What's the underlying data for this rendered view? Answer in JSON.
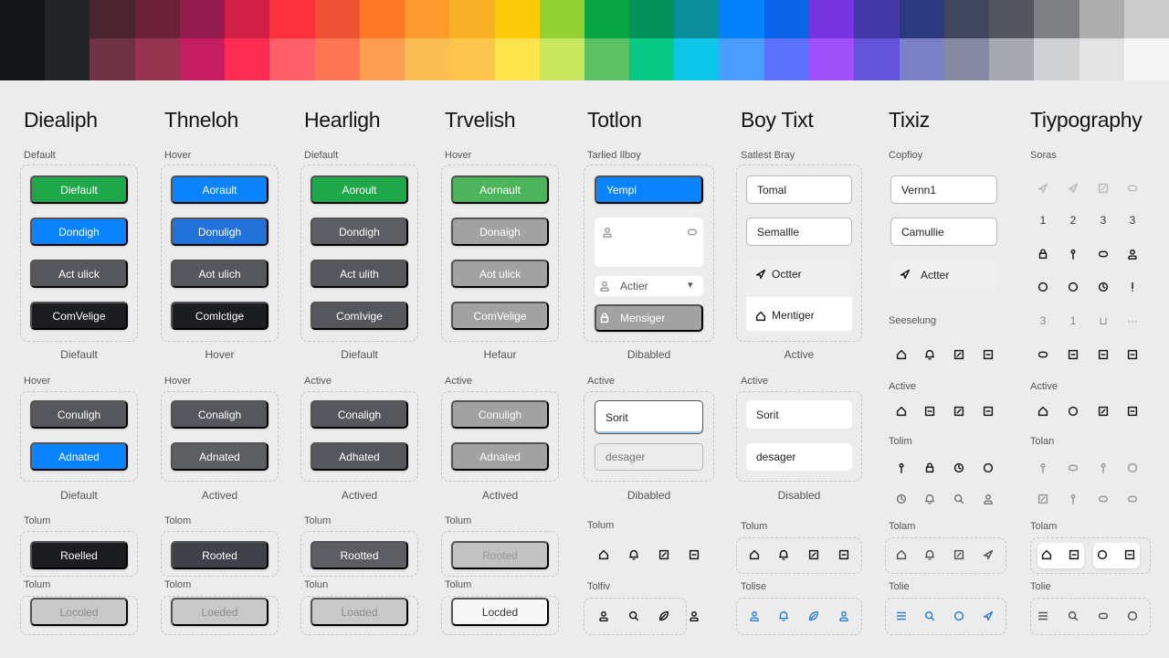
{
  "palette": {
    "top": [
      "#141518",
      "#232428",
      "#4a2530",
      "#6b2238",
      "#951a4d",
      "#d41f45",
      "#fd303b",
      "#ef5233",
      "#fe7726",
      "#fe9a2c",
      "#f8b026",
      "#fecb0a",
      "#93d032",
      "#07a544",
      "#05925a",
      "#078e9a",
      "#0482fd",
      "#0a64e8",
      "#7735e2",
      "#4438a8",
      "#2b3a7e",
      "#414760",
      "#54565f",
      "#7f8083",
      "#adadad",
      "#cccccc"
    ],
    "bottom": [
      "#141518",
      "#232428",
      "#6e3244",
      "#963450",
      "#c61e63",
      "#fd2b52",
      "#fe6068",
      "#fe7650",
      "#fe9d4f",
      "#fdbd55",
      "#fdc54b",
      "#fde44a",
      "#c9e75f",
      "#5bc263",
      "#07c885",
      "#0ec6e8",
      "#4a9dfe",
      "#5c71fe",
      "#a050fb",
      "#6353d8",
      "#7b81c7",
      "#8589a3",
      "#a6a9b0",
      "#d0d1d3",
      "#e3e3e3",
      "#f5f5f5"
    ]
  },
  "button_columns": [
    {
      "heading": "Diealiph",
      "label1": "Default",
      "buttons1": [
        {
          "text": "Diefault",
          "color": "#1ea84a"
        },
        {
          "text": "Dondigh",
          "color": "#0a84fe"
        },
        {
          "text": "Act ulick",
          "color": "#55575c"
        },
        {
          "text": "ComVelige",
          "color": "#1c1d20"
        }
      ],
      "caption1": "Diefault",
      "label2": "Hover",
      "buttons2": [
        {
          "text": "Conuligh",
          "color": "#55575c"
        },
        {
          "text": "Adnated",
          "color": "#0a84fe"
        }
      ],
      "caption2": "Diefault",
      "label3": "Tolum",
      "button3": {
        "text": "Roelled",
        "color": "#1c1d20"
      },
      "label4": "Tolum",
      "button4": {
        "text": "Locoled",
        "color": "#c9c9c9",
        "fg": "#8a8a8a"
      }
    },
    {
      "heading": "Thneloh",
      "label1": "Hover",
      "buttons1": [
        {
          "text": "Aorault",
          "color": "#0a84fe"
        },
        {
          "text": "Donuligh",
          "color": "#2271d8"
        },
        {
          "text": "Aot ulich",
          "color": "#55575c"
        },
        {
          "text": "Comlctige",
          "color": "#1c1d20"
        }
      ],
      "caption1": "Hover",
      "label2": "Hover",
      "buttons2": [
        {
          "text": "Conaligh",
          "color": "#55575c"
        },
        {
          "text": "Adnated",
          "color": "#5d5e62"
        }
      ],
      "caption2": "Actived",
      "label3": "Tolom",
      "button3": {
        "text": "Rooted",
        "color": "#3e414a"
      },
      "label4": "Tolom",
      "button4": {
        "text": "Loeded",
        "color": "#c9c9c9",
        "fg": "#8a8a8a"
      }
    },
    {
      "heading": "Hearligh",
      "label1": "Diefault",
      "buttons1": [
        {
          "text": "Aoroult",
          "color": "#1ea84a"
        },
        {
          "text": "Dondigh",
          "color": "#5d5e63"
        },
        {
          "text": "Act ulith",
          "color": "#55575c"
        },
        {
          "text": "ComIvige",
          "color": "#55575c"
        }
      ],
      "caption1": "Diefault",
      "label2": "Active",
      "buttons2": [
        {
          "text": "Conaligh",
          "color": "#55575c"
        },
        {
          "text": "Adhated",
          "color": "#55575c"
        }
      ],
      "caption2": "Actived",
      "label3": "Tolum",
      "button3": {
        "text": "Rootted",
        "color": "#5d5e63"
      },
      "label4": "Tolun",
      "button4": {
        "text": "Loaded",
        "color": "#c9c9c9",
        "fg": "#8a8a8a"
      }
    },
    {
      "heading": "Trvelish",
      "label1": "Hover",
      "buttons1": [
        {
          "text": "Aornault",
          "color": "#4cb55c"
        },
        {
          "text": "Donaigh",
          "color": "#a2a2a2"
        },
        {
          "text": "Aot ulick",
          "color": "#a2a2a2"
        },
        {
          "text": "ComVelige",
          "color": "#a2a2a2"
        }
      ],
      "caption1": "Hefaur",
      "label2": "Active",
      "buttons2": [
        {
          "text": "Conuligh",
          "color": "#a2a2a2"
        },
        {
          "text": "Adnated",
          "color": "#a2a2a2"
        }
      ],
      "caption2": "Actived",
      "label3": "Tolum",
      "button3": {
        "text": "Rooted",
        "color": "#c2c2c2",
        "fg": "#999"
      },
      "label4": "Tolum",
      "button4": {
        "text": "Locded",
        "color": "#f6f6f6",
        "fg": "#333"
      }
    }
  ],
  "col5": {
    "heading": "Totlon",
    "label1": "Tarlied Ilboy",
    "primary": "Yempl",
    "select": "Actier",
    "disabled_btn": "Mensiger",
    "caption1": "Dibabled",
    "label2": "Active",
    "input_focus": "Sorit",
    "input_placeholder": "desager",
    "caption2": "Dibabled",
    "label3": "Tolum",
    "icons3": [
      "home",
      "bell",
      "edit",
      "square"
    ],
    "label4": "Tolfiv",
    "icons4": [
      "user",
      "search",
      "leaf",
      "user"
    ]
  },
  "col6": {
    "heading": "Boy Tixt",
    "label1": "Satlest Bray",
    "input1": "Tomal",
    "input2": "Semallle",
    "item1": "Octter",
    "item2": "Mentiger",
    "caption1": "Active",
    "label2": "Active",
    "input3": "Sorit",
    "input4": "desager",
    "caption2": "Disabled",
    "label3": "Tolum",
    "icons3": [
      "home",
      "bell",
      "edit",
      "square"
    ],
    "label4": "Tolise",
    "icons4": [
      "user",
      "bell",
      "leaf",
      "user"
    ]
  },
  "col7": {
    "heading": "Tixiz",
    "label1": "Copfioy",
    "input1": "Vernn1",
    "input2": "Camullie",
    "item1": "Actter",
    "label2": "Seeselung",
    "icons2": [
      "home",
      "bell",
      "edit",
      "square"
    ],
    "label3": "Active",
    "icons3": [
      "home",
      "square",
      "edit",
      "square"
    ],
    "label4": "Tolim",
    "icons4a": [
      "key",
      "lock",
      "clock",
      "circle"
    ],
    "icons4b": [
      "clock",
      "bell",
      "search",
      "user"
    ],
    "label5": "Tolam",
    "icons5": [
      "home",
      "bell",
      "edit",
      "send"
    ],
    "label6": "Tolie",
    "icons6": [
      "menu",
      "search",
      "circle",
      "send"
    ]
  },
  "col8": {
    "heading": "Tiypography",
    "label1": "Soras",
    "row_icons": [
      "send",
      "send",
      "edit",
      "pill"
    ],
    "row_nums1": [
      "1",
      "2",
      "3",
      "3"
    ],
    "row_icons2": [
      "lock",
      "key",
      "pill",
      "user"
    ],
    "row_icons3": [
      "circle",
      "circle",
      "clock",
      "excl"
    ],
    "row_nums2": [
      "3",
      "1",
      "⊔",
      "···"
    ],
    "row_icons4": [
      "pill",
      "square",
      "square",
      "square"
    ],
    "label2": "Active",
    "icons2": [
      "home",
      "circle",
      "edit",
      "square"
    ],
    "label3": "Tolan",
    "icons3a": [
      "key",
      "pill",
      "key",
      "circle"
    ],
    "icons3b": [
      "edit",
      "key",
      "pill",
      "pill"
    ],
    "label4": "Tolam",
    "icons4": [
      "home",
      "square",
      "circle",
      "square"
    ],
    "label5": "Tolie",
    "icons5": [
      "menu",
      "search",
      "pill",
      "circle"
    ]
  },
  "colors": {
    "accent": "#0a84fe",
    "green": "#1ea84a"
  }
}
